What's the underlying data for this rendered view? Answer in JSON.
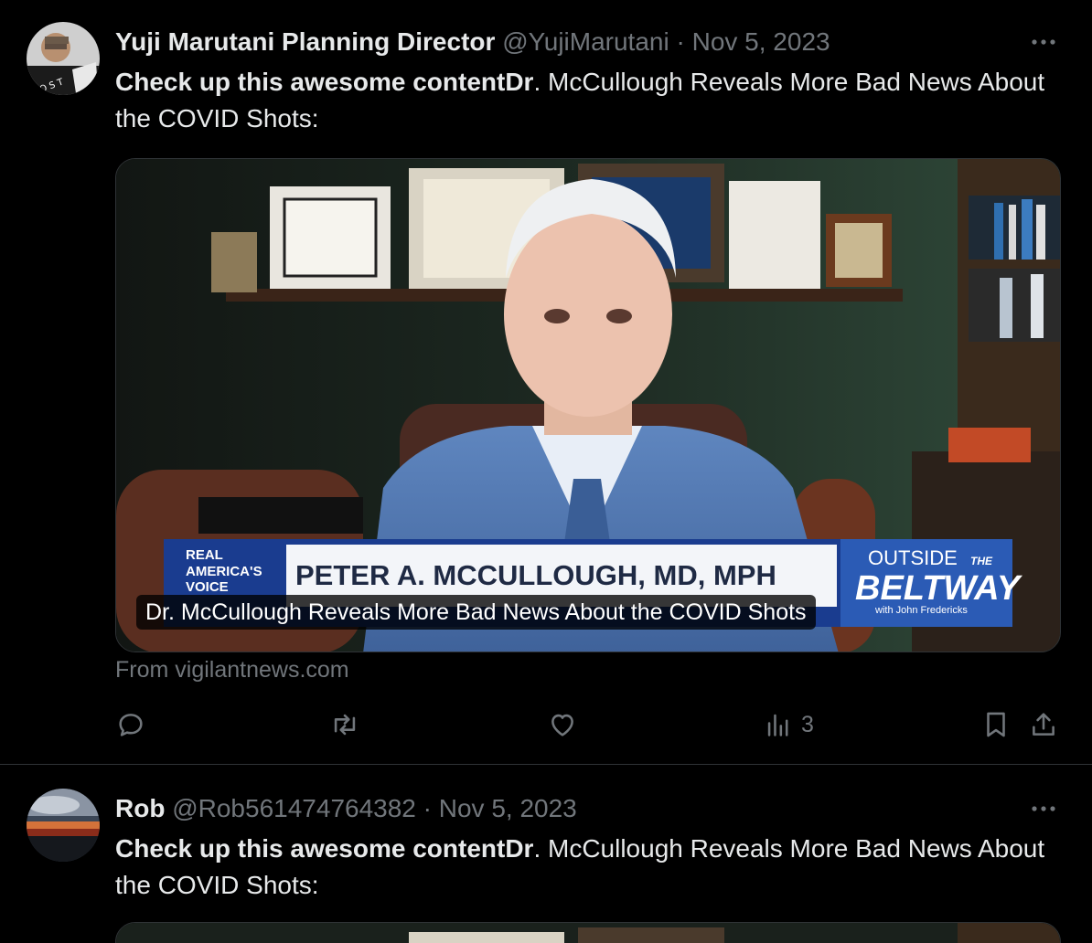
{
  "tweets": [
    {
      "author_name": "Yuji Marutani Planning Director",
      "author_handle": "@YujiMarutani",
      "separator": "·",
      "date": "Nov 5, 2023",
      "text_bold": "Check up this awesome contentDr",
      "text_rest": ". McCullough Reveals More Bad News About the COVID Shots:",
      "card": {
        "caption": "Dr. McCullough Reveals More Bad News About the COVID Shots",
        "lower_third": {
          "network_line1": "REAL",
          "network_line2": "AMERICA'S",
          "network_line3": "VOICE",
          "name": "PETER A. MCCULLOUGH, MD, MPH",
          "show_line1": "OUTSIDE",
          "show_line1b": "THE",
          "show_line2": "BELTWAY",
          "show_host": "with John Fredericks"
        }
      },
      "source": "From vigilantnews.com",
      "actions": {
        "reply_icon": "reply-icon",
        "retweet_icon": "retweet-icon",
        "like_icon": "like-icon",
        "views_icon": "views-icon",
        "views_count": "3",
        "bookmark_icon": "bookmark-icon",
        "share_icon": "share-icon"
      }
    },
    {
      "author_name": "Rob",
      "author_handle": "@Rob561474764382",
      "separator": "·",
      "date": "Nov 5, 2023",
      "text_bold": "Check up this awesome contentDr",
      "text_rest": ". McCullough Reveals More Bad News About the COVID Shots:"
    }
  ],
  "colors": {
    "background": "#000000",
    "text": "#e7e9ea",
    "secondary": "#71767b",
    "divider": "#2f3336"
  }
}
